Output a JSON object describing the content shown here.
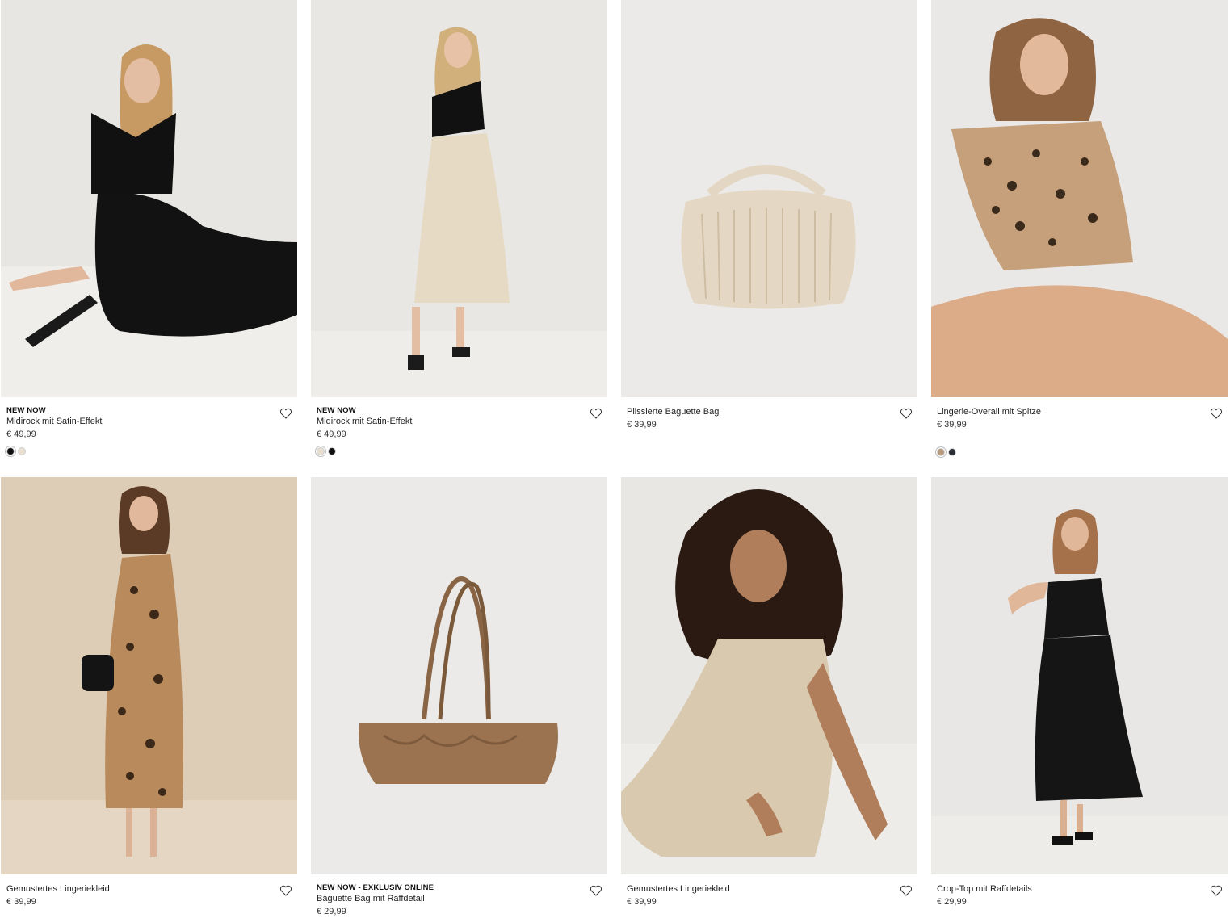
{
  "products": [
    {
      "badge": "NEW NOW",
      "name": "Midirock mit Satin-Effekt",
      "price": "€ 49,99",
      "icon": "heart-icon",
      "colors": [
        "#111111",
        "#e9e0d2"
      ],
      "image": "model-black-satin-skirt-sitting"
    },
    {
      "badge": "NEW NOW",
      "name": "Midirock mit Satin-Effekt",
      "price": "€ 49,99",
      "icon": "heart-icon",
      "colors": [
        "#e9e0d2",
        "#111111"
      ],
      "image": "model-beige-satin-skirt-standing"
    },
    {
      "badge": "",
      "name": "Plissierte Baguette Bag",
      "price": "€ 39,99",
      "icon": "heart-icon",
      "colors": [],
      "image": "beige-pleated-bag"
    },
    {
      "badge": "",
      "name": "Lingerie-Overall mit Spitze",
      "price": "€ 39,99",
      "icon": "heart-icon",
      "colors": [
        "#b79b7f",
        "#2b2e35"
      ],
      "image": "model-leopard-playsuit-sitting"
    },
    {
      "badge": "",
      "name": "Gemustertes Lingeriekleid",
      "price": "€ 39,99",
      "icon": "heart-icon",
      "colors": [],
      "image": "model-leopard-slip-dress"
    },
    {
      "badge": "NEW NOW - EXKLUSIV ONLINE",
      "name": "Baguette Bag mit Raffdetail",
      "price": "€ 29,99",
      "icon": "heart-icon",
      "colors": [],
      "image": "brown-ruched-shoulder-bag"
    },
    {
      "badge": "",
      "name": "Gemustertes Lingeriekleid",
      "price": "€ 39,99",
      "icon": "heart-icon",
      "colors": [],
      "image": "model-beige-slip-dress-sitting"
    },
    {
      "badge": "",
      "name": "Crop-Top mit Raffdetails",
      "price": "€ 29,99",
      "icon": "heart-icon",
      "colors": [],
      "image": "model-black-halter-top-skirt"
    }
  ]
}
